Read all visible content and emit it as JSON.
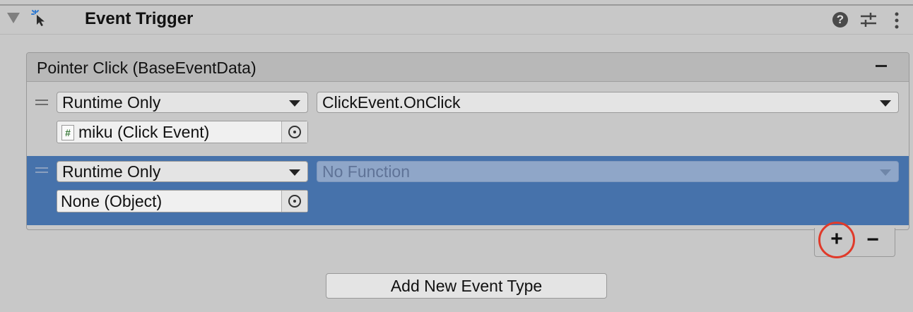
{
  "component": {
    "title": "Event Trigger",
    "icon": "event-trigger-icon"
  },
  "event_list": {
    "title": "Pointer Click (BaseEventData)",
    "entries": [
      {
        "call_state": "Runtime Only",
        "function": "ClickEvent.OnClick",
        "target": "miku (Click Event)",
        "target_icon": "#",
        "selected": false
      },
      {
        "call_state": "Runtime Only",
        "function": "No Function",
        "target": "None (Object)",
        "selected": true
      }
    ]
  },
  "footer": {
    "add_label": "+",
    "remove_label": "−"
  },
  "add_event_button": "Add New Event Type",
  "colors": {
    "background": "#c8c8c8",
    "selected_row": "#4672ab",
    "highlight_circle": "#e03a2a"
  }
}
